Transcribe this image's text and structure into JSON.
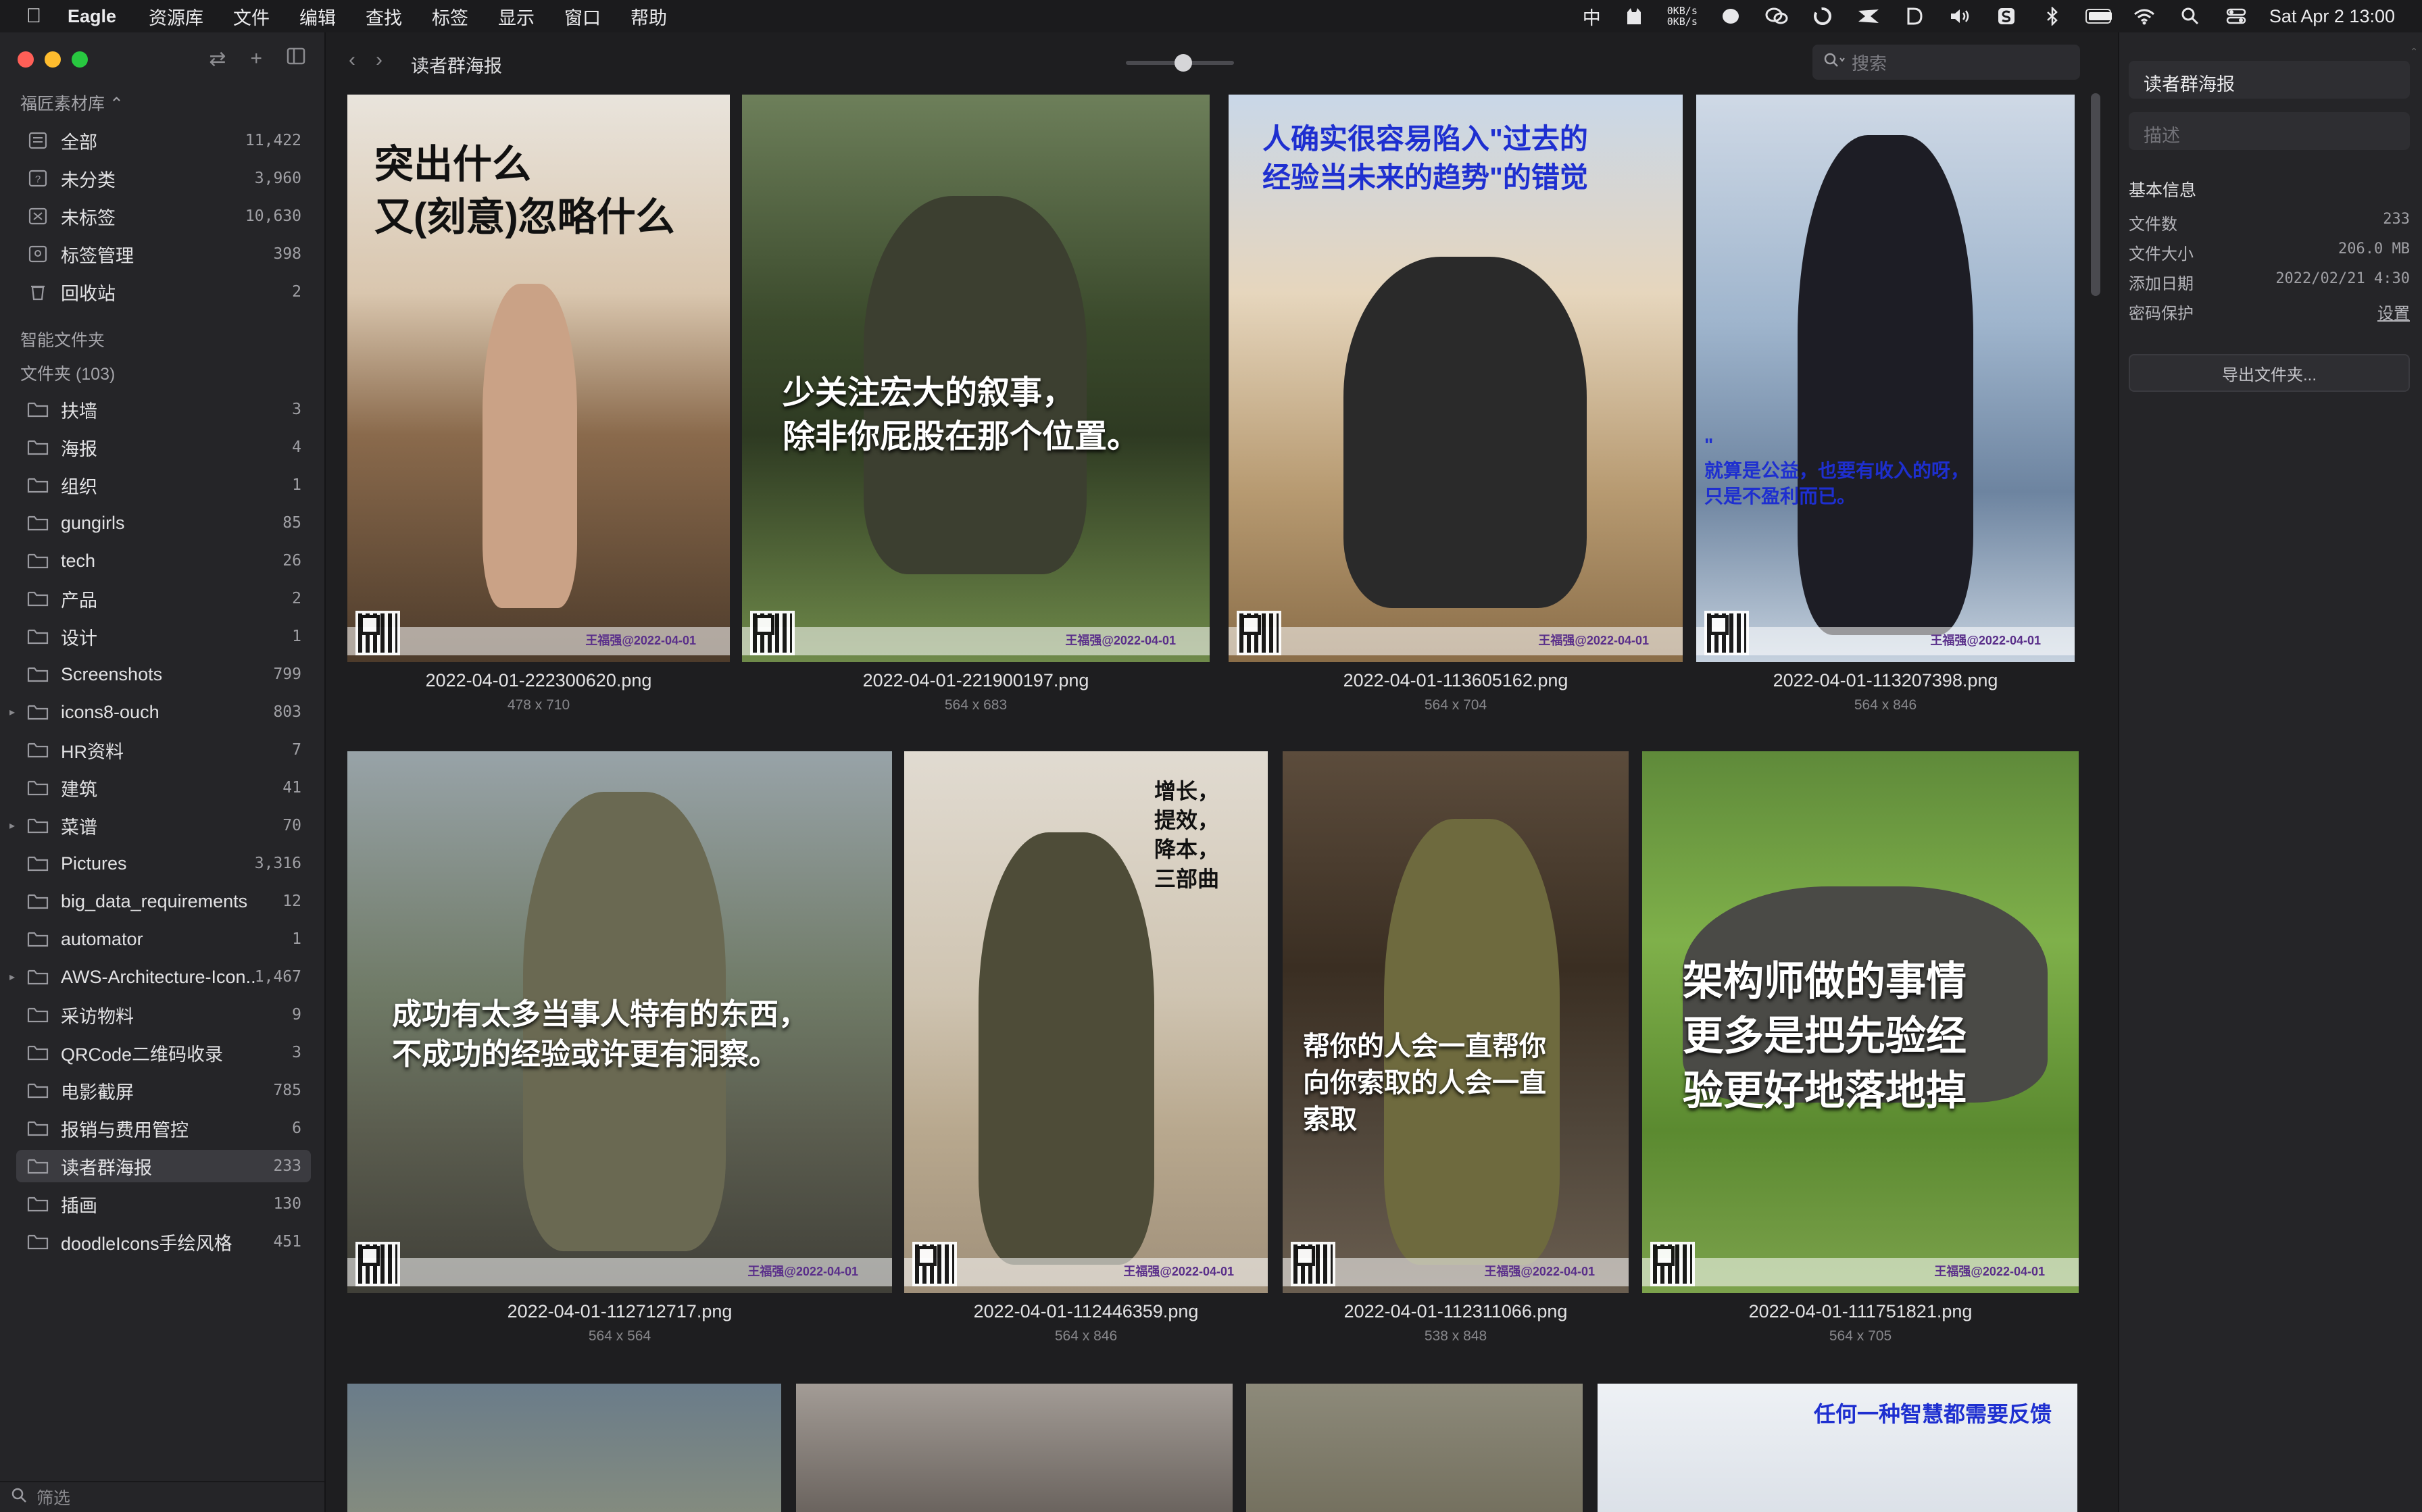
{
  "menubar": {
    "app": "Eagle",
    "items": [
      "资源库",
      "文件",
      "编辑",
      "查找",
      "标签",
      "显示",
      "窗口",
      "帮助"
    ],
    "ime": "中",
    "net_up": "0KB/s",
    "net_down": "0KB/s",
    "clock": "Sat Apr 2  13:00"
  },
  "sidebar": {
    "library": "福匠素材库 ⌃",
    "quick": [
      {
        "label": "全部",
        "count": "11,422",
        "icon": "all-items-icon"
      },
      {
        "label": "未分类",
        "count": "3,960",
        "icon": "uncategorized-icon"
      },
      {
        "label": "未标签",
        "count": "10,630",
        "icon": "untagged-icon"
      },
      {
        "label": "标签管理",
        "count": "398",
        "icon": "tag-manager-icon"
      },
      {
        "label": "回收站",
        "count": "2",
        "icon": "trash-icon"
      }
    ],
    "smart_title": "智能文件夹",
    "folders_title": "文件夹 (103)",
    "folders": [
      {
        "label": "扶墙",
        "count": "3"
      },
      {
        "label": "海报",
        "count": "4"
      },
      {
        "label": "组织",
        "count": "1"
      },
      {
        "label": "gungirls",
        "count": "85"
      },
      {
        "label": "tech",
        "count": "26"
      },
      {
        "label": "产品",
        "count": "2"
      },
      {
        "label": "设计",
        "count": "1"
      },
      {
        "label": "Screenshots",
        "count": "799"
      },
      {
        "label": "icons8-ouch",
        "count": "803"
      },
      {
        "label": "HR资料",
        "count": "7"
      },
      {
        "label": "建筑",
        "count": "41"
      },
      {
        "label": "菜谱",
        "count": "70"
      },
      {
        "label": "Pictures",
        "count": "3,316"
      },
      {
        "label": "big_data_requirements",
        "count": "12"
      },
      {
        "label": "automator",
        "count": "1"
      },
      {
        "label": "AWS-Architecture-Icon...",
        "count": "1,467"
      },
      {
        "label": "采访物料",
        "count": "9"
      },
      {
        "label": "QRCode二维码收录",
        "count": "3"
      },
      {
        "label": "电影截屏",
        "count": "785"
      },
      {
        "label": "报销与费用管控",
        "count": "6"
      },
      {
        "label": "读者群海报",
        "count": "233"
      },
      {
        "label": "插画",
        "count": "130"
      },
      {
        "label": "doodleIcons手绘风格",
        "count": "451"
      }
    ],
    "filter_placeholder": "筛选"
  },
  "toolbar": {
    "breadcrumb": "读者群海报",
    "zoom_level": 0.45,
    "search_placeholder": "搜索"
  },
  "grid": {
    "watermark": "王福强@2022-04-01",
    "items": [
      {
        "name": "2022-04-01-222300620.png",
        "dims": "478 x 710",
        "caption": "突出什么\n又(刻意)忽略什么"
      },
      {
        "name": "2022-04-01-221900197.png",
        "dims": "564 x 683",
        "caption": "少关注宏大的叙事，\n除非你屁股在那个位置。"
      },
      {
        "name": "2022-04-01-113605162.png",
        "dims": "564 x 704",
        "caption": "人确实很容易陷入\"过去的\n经验当未来的趋势\"的错觉"
      },
      {
        "name": "2022-04-01-113207398.png",
        "dims": "564 x 846",
        "caption": "\"\n就算是公益，也要有收入的呀，\n只是不盈利而已。"
      },
      {
        "name": "2022-04-01-112712717.png",
        "dims": "564 x 564",
        "caption": "成功有太多当事人特有的东西，\n不成功的经验或许更有洞察。"
      },
      {
        "name": "2022-04-01-112446359.png",
        "dims": "564 x 846",
        "caption": "增长，\n提效，\n降本，\n三部曲"
      },
      {
        "name": "2022-04-01-112311066.png",
        "dims": "538 x 848",
        "caption": "帮你的人会一直帮你\n向你索取的人会一直\n索取"
      },
      {
        "name": "2022-04-01-111751821.png",
        "dims": "564 x 705",
        "caption": "架构师做的事情\n更多是把先验经\n验更好地落地掉"
      },
      {
        "name": "",
        "dims": "",
        "caption": ""
      },
      {
        "name": "",
        "dims": "",
        "caption": ""
      },
      {
        "name": "",
        "dims": "",
        "caption": ""
      },
      {
        "name": "",
        "dims": "",
        "caption": "任何一种智慧都需要反馈"
      }
    ]
  },
  "inspector": {
    "title": "读者群海报",
    "desc_placeholder": "描述",
    "section": "基本信息",
    "rows": [
      {
        "k": "文件数",
        "v": "233"
      },
      {
        "k": "文件大小",
        "v": "206.0 MB"
      },
      {
        "k": "添加日期",
        "v": "2022/02/21 4:30"
      },
      {
        "k": "密码保护",
        "v": "设置"
      }
    ],
    "export_label": "导出文件夹..."
  },
  "colors": {
    "traffic_red": "#ff5f57",
    "traffic_yellow": "#febc2e",
    "traffic_green": "#28c840",
    "watermark": "#5a2f8a"
  }
}
